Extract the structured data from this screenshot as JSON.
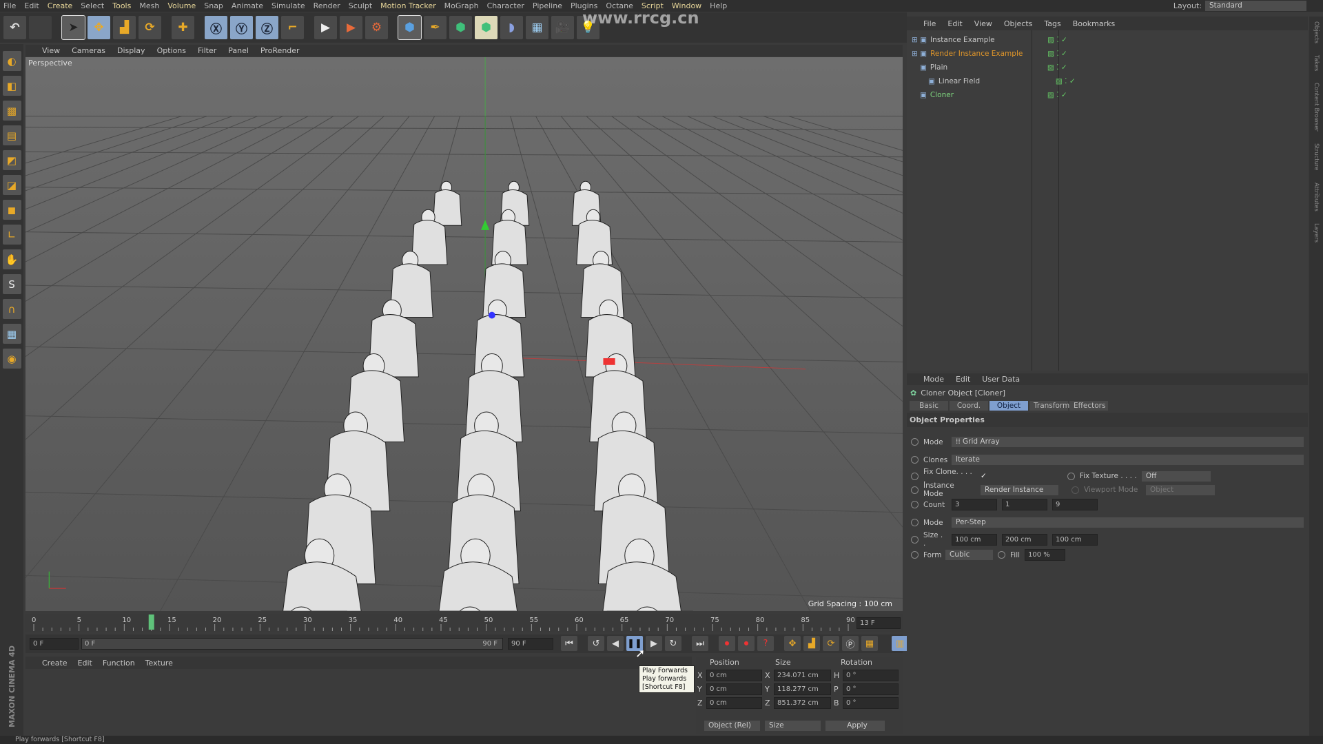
{
  "menubar": {
    "items": [
      "File",
      "Edit",
      "Create",
      "Select",
      "Tools",
      "Mesh",
      "Volume",
      "Snap",
      "Animate",
      "Simulate",
      "Render",
      "Sculpt",
      "Motion Tracker",
      "MoGraph",
      "Character",
      "Pipeline",
      "Plugins",
      "Octane",
      "Script",
      "Window",
      "Help"
    ],
    "highlighted": [
      "Create",
      "Tools",
      "Volume",
      "Motion Tracker",
      "Script",
      "Window"
    ],
    "layout_label": "Layout:",
    "layout_value": "Standard"
  },
  "watermark": "www.rrcg.cn",
  "viewport": {
    "menu": [
      "View",
      "Cameras",
      "Display",
      "Options",
      "Filter",
      "Panel",
      "ProRender"
    ],
    "camera_label": "Perspective",
    "grid_spacing": "Grid Spacing : 100 cm"
  },
  "timeline": {
    "ticks": [
      "0",
      "5",
      "10",
      "15",
      "20",
      "25",
      "30",
      "35",
      "40",
      "45",
      "50",
      "55",
      "60",
      "65",
      "70",
      "75",
      "80",
      "85",
      "90"
    ],
    "current_frame": "13 F",
    "playhead_frame": 13,
    "start": "0 F",
    "range_start": "0 F",
    "range_end": "90 F",
    "end": "90 F"
  },
  "material_menu": [
    "Create",
    "Edit",
    "Function",
    "Texture"
  ],
  "tooltip": {
    "title": "Play Forwards",
    "line1": "Play forwards",
    "line2": "[Shortcut F8]"
  },
  "coords": {
    "headers": [
      "Position",
      "Size",
      "Rotation"
    ],
    "rows": [
      {
        "axis": "X",
        "pos": "0 cm",
        "size_axis": "X",
        "size": "234.071 cm",
        "rot_axis": "H",
        "rot": "0 °"
      },
      {
        "axis": "Y",
        "pos": "0 cm",
        "size_axis": "Y",
        "size": "118.277 cm",
        "rot_axis": "P",
        "rot": "0 °"
      },
      {
        "axis": "Z",
        "pos": "0 cm",
        "size_axis": "Z",
        "size": "851.372 cm",
        "rot_axis": "B",
        "rot": "0 °"
      }
    ],
    "mode": "Object (Rel)",
    "size_mode": "Size",
    "apply": "Apply"
  },
  "object_manager": {
    "menu": [
      "File",
      "Edit",
      "View",
      "Objects",
      "Tags",
      "Bookmarks"
    ],
    "objects": [
      {
        "name": "Instance Example",
        "indent": 0,
        "color": "#c8c8c8"
      },
      {
        "name": "Render Instance Example",
        "indent": 0,
        "color": "#e0962a"
      },
      {
        "name": "Plain",
        "indent": 1,
        "color": "#c8c8c8"
      },
      {
        "name": "Linear Field",
        "indent": 2,
        "color": "#c8c8c8"
      },
      {
        "name": "Cloner",
        "indent": 1,
        "color": "#7fd67f"
      }
    ]
  },
  "attributes": {
    "menu": [
      "Mode",
      "Edit",
      "User Data"
    ],
    "title": "Cloner Object [Cloner]",
    "tabs": [
      "Basic",
      "Coord.",
      "Object",
      "Transform",
      "Effectors"
    ],
    "active_tab": "Object",
    "section": "Object Properties",
    "mode_label": "Mode",
    "mode_value": "Grid Array",
    "clones_label": "Clones",
    "clones_value": "Iterate",
    "fix_clone_label": "Fix Clone. . . . .",
    "fix_clone_checked": true,
    "fix_texture_label": "Fix Texture . . . .",
    "fix_texture_value": "Off",
    "instance_mode_label": "Instance Mode",
    "instance_mode_value": "Render Instance",
    "viewport_mode_label": "Viewport Mode",
    "viewport_mode_value": "Object",
    "count_label": "Count",
    "count": [
      "3",
      "1",
      "9"
    ],
    "mode2_label": "Mode",
    "mode2_value": "Per-Step",
    "size_label": "Size . .",
    "size": [
      "100 cm",
      "200 cm",
      "100 cm"
    ],
    "form_label": "Form",
    "form_value": "Cubic",
    "fill_label": "Fill",
    "fill_value": "100 %"
  },
  "side_tabs": [
    "Objects",
    "Takes",
    "Content Browser",
    "Structure",
    "Attributes",
    "Layers"
  ],
  "status": "Play forwards [Shortcut F8]",
  "brand": "MAXON CINEMA 4D"
}
